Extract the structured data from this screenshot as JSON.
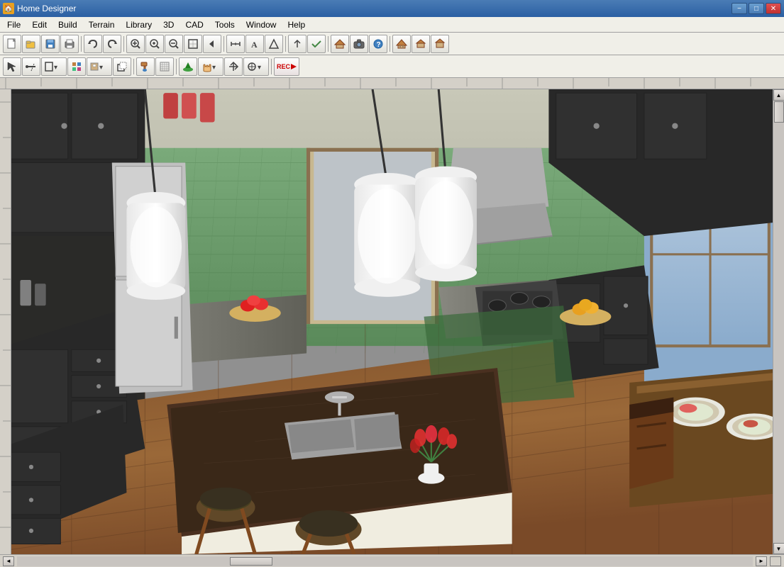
{
  "window": {
    "title": "Home Designer",
    "icon": "🏠"
  },
  "title_controls": {
    "minimize": "−",
    "maximize": "□",
    "close": "✕"
  },
  "menu": {
    "items": [
      {
        "id": "file",
        "label": "File"
      },
      {
        "id": "edit",
        "label": "Edit"
      },
      {
        "id": "build",
        "label": "Build"
      },
      {
        "id": "terrain",
        "label": "Terrain"
      },
      {
        "id": "library",
        "label": "Library"
      },
      {
        "id": "3d",
        "label": "3D"
      },
      {
        "id": "cad",
        "label": "CAD"
      },
      {
        "id": "tools",
        "label": "Tools"
      },
      {
        "id": "window",
        "label": "Window"
      },
      {
        "id": "help",
        "label": "Help"
      }
    ]
  },
  "toolbar1": {
    "buttons": [
      {
        "id": "new",
        "icon": "📄",
        "tooltip": "New"
      },
      {
        "id": "open",
        "icon": "📂",
        "tooltip": "Open"
      },
      {
        "id": "save",
        "icon": "💾",
        "tooltip": "Save"
      },
      {
        "id": "print",
        "icon": "🖨",
        "tooltip": "Print"
      },
      {
        "id": "undo",
        "icon": "↩",
        "tooltip": "Undo"
      },
      {
        "id": "redo",
        "icon": "↪",
        "tooltip": "Redo"
      },
      {
        "id": "zoom-in",
        "icon": "🔍",
        "tooltip": "Zoom In"
      },
      {
        "id": "zoom-in2",
        "icon": "⊕",
        "tooltip": "Zoom In"
      },
      {
        "id": "zoom-out",
        "icon": "⊖",
        "tooltip": "Zoom Out"
      },
      {
        "id": "fit",
        "icon": "⊞",
        "tooltip": "Fit"
      },
      {
        "id": "prev-view",
        "icon": "◁",
        "tooltip": "Previous View"
      },
      {
        "id": "tools-a",
        "icon": "≋",
        "tooltip": "Tools"
      },
      {
        "id": "tools-b",
        "icon": "△",
        "tooltip": "Elevation"
      },
      {
        "id": "roof",
        "icon": "⌂",
        "tooltip": "Roof"
      },
      {
        "id": "camera",
        "icon": "📷",
        "tooltip": "Camera"
      },
      {
        "id": "help-btn",
        "icon": "?",
        "tooltip": "Help"
      },
      {
        "id": "view1",
        "icon": "⌂",
        "tooltip": "2D View"
      },
      {
        "id": "view2",
        "icon": "🏠",
        "tooltip": "3D View"
      },
      {
        "id": "view3",
        "icon": "⌂",
        "tooltip": "Plan View"
      }
    ]
  },
  "toolbar2": {
    "buttons": [
      {
        "id": "select",
        "icon": "↖",
        "tooltip": "Select"
      },
      {
        "id": "draw",
        "icon": "⌐",
        "tooltip": "Draw"
      },
      {
        "id": "room",
        "icon": "▭",
        "tooltip": "Room"
      },
      {
        "id": "material",
        "icon": "▦",
        "tooltip": "Material"
      },
      {
        "id": "cabinet",
        "icon": "▣",
        "tooltip": "Cabinet"
      },
      {
        "id": "copy",
        "icon": "⧉",
        "tooltip": "Copy"
      },
      {
        "id": "record",
        "icon": "⏺",
        "tooltip": "Record"
      },
      {
        "id": "paint",
        "icon": "🖌",
        "tooltip": "Paint"
      },
      {
        "id": "terrain2",
        "icon": "🌿",
        "tooltip": "Terrain"
      },
      {
        "id": "hand",
        "icon": "✋",
        "tooltip": "Pan"
      },
      {
        "id": "arrow",
        "icon": "↑",
        "tooltip": "Arrow"
      },
      {
        "id": "transform",
        "icon": "⊕",
        "tooltip": "Transform"
      },
      {
        "id": "rec-btn",
        "icon": "REC",
        "tooltip": "Record"
      }
    ]
  },
  "status": {
    "scroll_left": "◄",
    "scroll_right": "►"
  }
}
